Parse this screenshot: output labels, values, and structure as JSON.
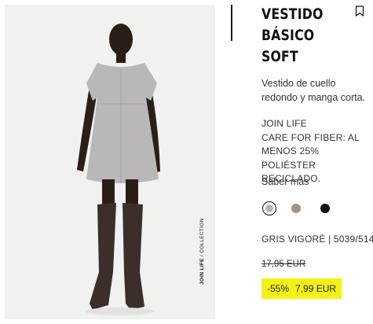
{
  "product": {
    "title_lines": [
      "VESTIDO",
      "BÁSICO",
      "SOFT"
    ],
    "description_lines": [
      "Vestido de cuello",
      "redondo y manga corta."
    ],
    "join_life_lines": [
      "JOIN LIFE",
      "CARE FOR FIBER: AL",
      "MENOS 25% POLIÉSTER",
      "RECICLADO."
    ],
    "more_link": "Saber más",
    "color_reference": "GRIS VIGORÉ | 5039/514",
    "old_price": "17,95 EUR",
    "discount": "-55%",
    "sale_price": "7,99 EUR",
    "collection_tag_bold": "JOIN LIFE",
    "collection_tag_rest": " / COLLECTION"
  },
  "swatches": [
    {
      "name": "gris",
      "color": "#b4b4b4",
      "selected": true
    },
    {
      "name": "taupe",
      "color": "#a5917f",
      "selected": false
    },
    {
      "name": "negro",
      "color": "#111111",
      "selected": false
    }
  ],
  "colors": {
    "sale_highlight": "#f5f116",
    "text": "#1a1a1a",
    "photo_background": "#f1f1f0"
  },
  "icons": {
    "bookmark": "bookmark-icon"
  }
}
